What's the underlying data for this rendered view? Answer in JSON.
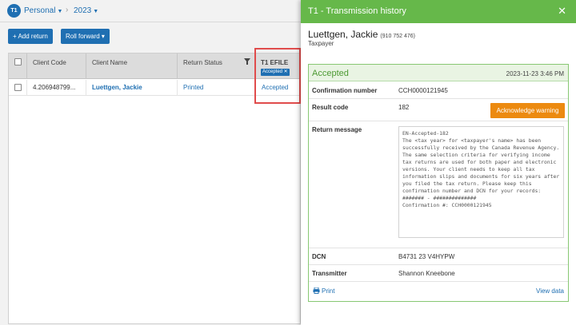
{
  "topbar": {
    "badge": "T1",
    "product": "Personal",
    "year": "2023"
  },
  "toolbar": {
    "add_return": "+ Add return",
    "roll_forward": "Roll forward ▾"
  },
  "grid": {
    "columns": [
      "Client Code",
      "Client Name",
      "Return Status",
      "T1 EFILE"
    ],
    "filter_tag": "Accepted ✕",
    "rows": [
      {
        "client_code": "4.206948799...",
        "client_name": "Luettgen, Jackie",
        "return_status": "Printed",
        "efile": "Accepted"
      }
    ]
  },
  "panel": {
    "title": "T1 - Transmission history",
    "close": "✕",
    "taxpayer_name": "Luettgen, Jackie",
    "taxpayer_id": "(910 752 476)",
    "taxpayer_role": "Taxpayer",
    "status": "Accepted",
    "timestamp": "2023-11-23 3:46 PM",
    "fields": {
      "confirmation_label": "Confirmation number",
      "confirmation_value": "CCH0000121945",
      "result_label": "Result code",
      "result_value": "182",
      "ack_button": "Acknowledge warning",
      "message_label": "Return message",
      "message_value": "EN-Accepted-182\nThe <tax year> for <taxpayer's name> has been successfully received by the Canada Revenue Agency. The same selection criteria for verifying income tax returns are used for both paper and electronic versions. Your client needs to keep all tax information slips and documents for six years after you filed the tax return. Please keep this confirmation number and DCN for your records:  ####### - ##############\nConfirmation #: CCH0000121945",
      "dcn_label": "DCN",
      "dcn_value": "B4731 23 V4HYPW",
      "transmitter_label": "Transmitter",
      "transmitter_value": "Shannon Kneebone"
    },
    "print": "Print",
    "view_data": "View data"
  },
  "colors": {
    "brand_blue": "#1f6fb2",
    "panel_green": "#66b84a",
    "accepted_green": "#4d9a33",
    "warning_orange": "#ec8a10",
    "highlight_red": "#e04c4c"
  }
}
